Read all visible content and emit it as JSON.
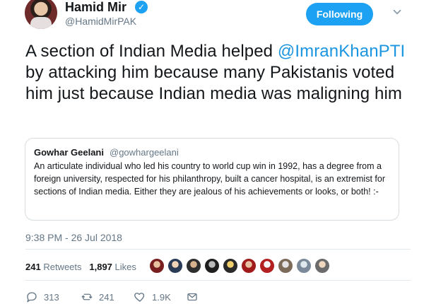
{
  "colors": {
    "brand": "#1da1f2",
    "link": "#1b95e0",
    "text": "#14171a",
    "muted": "#657786",
    "border": "#d7dce0",
    "divider": "#e1e8ed"
  },
  "header": {
    "avatar_icon": "profile-avatar-icon",
    "name": "Hamid Mir",
    "verified_icon": "verified-badge-icon",
    "handle": "@HamidMirPAK",
    "follow_label": "Following",
    "menu_icon": "chevron-down-icon"
  },
  "tweet": {
    "text_before": "A section of Indian Media helped ",
    "mention": "@ImranKhanPTI",
    "text_after": " by attacking him because many Pakistanis voted him just because Indian media was maligning him"
  },
  "quoted_tweet": {
    "name": "Gowhar Geelani",
    "handle": "@gowhargeelani",
    "text": "An articulate individual who led his country to world cup  win in 1992, has a degree from a foreign university, respected for his philanthropy, built a cancer hospital, is an extremist for sections of Indian media. Either they are jealous of his achievements or looks, or both! :-"
  },
  "meta": {
    "timestamp": "9:38 PM - 26 Jul 2018"
  },
  "stats": {
    "retweets_count": "241",
    "retweets_label": "Retweets",
    "likes_count": "1,897",
    "likes_label": "Likes",
    "likers_icons": [
      "liker-avatar-icon",
      "liker-avatar-icon",
      "liker-avatar-icon",
      "liker-avatar-icon",
      "liker-avatar-icon",
      "liker-avatar-icon",
      "liker-avatar-icon",
      "liker-avatar-icon",
      "liker-avatar-icon",
      "liker-avatar-icon"
    ]
  },
  "actions": {
    "reply_icon": "reply-icon",
    "reply_count": "313",
    "retweet_icon": "retweet-icon",
    "retweet_count": "241",
    "like_icon": "heart-icon",
    "like_count": "1.9K",
    "dm_icon": "envelope-icon"
  }
}
